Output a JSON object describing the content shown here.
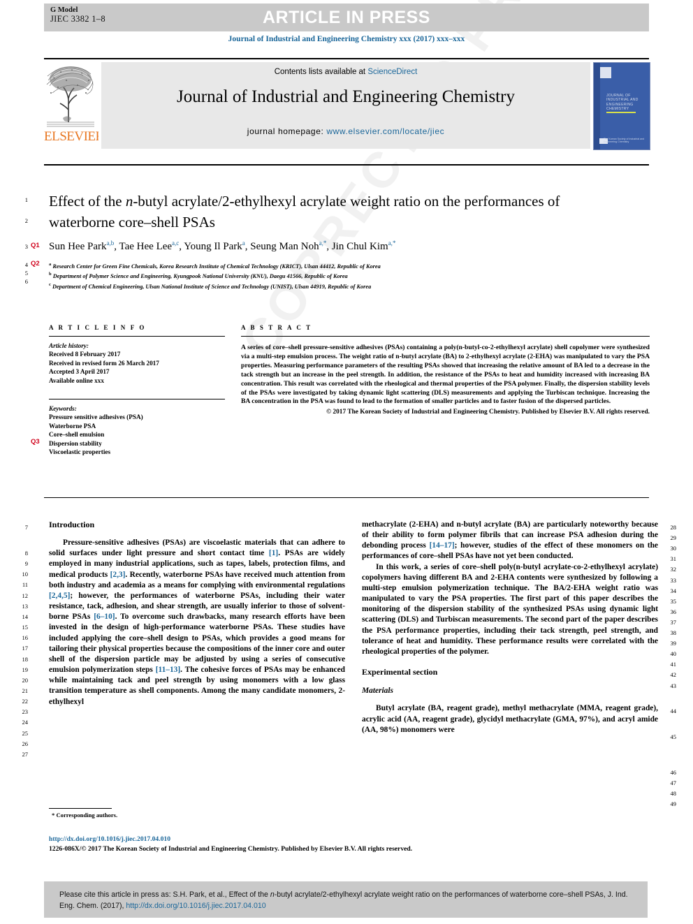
{
  "header": {
    "g_model": "G Model",
    "article_id": "JIEC 3382 1–8",
    "status_banner": "ARTICLE IN PRESS",
    "journal_citation": "Journal of Industrial and Engineering Chemistry xxx (2017) xxx–xxx"
  },
  "masthead": {
    "contents_prefix": "Contents lists available at ",
    "contents_link": "ScienceDirect",
    "journal_title": "Journal of Industrial and Engineering Chemistry",
    "homepage_label": "journal homepage:",
    "homepage_url": "www.elsevier.com/locate/jiec",
    "publisher_logo": "ELSEVIER",
    "cover": {
      "title_lines": "Journal of Industrial and Engineering Chemistry",
      "footer": "The Korean Society of Industrial and Engineering Chemistry"
    }
  },
  "article": {
    "title_part1": "Effect of the ",
    "title_italic": "n",
    "title_part2": "-butyl acrylate/2-ethylhexyl acrylate weight ratio on the performances of waterborne core–shell PSAs",
    "authors_html": "Sun Hee Park, Tae Hee Lee, Young Il Park, Seung Man Noh, Jin Chul Kim",
    "affiliations": [
      "Research Center for Green Fine Chemicals, Korea Research Institute of Chemical Technology (KRICT), Ulsan 44412, Republic of Korea",
      "Department of Polymer Science and Engineering, Kyungpook National University (KNU), Daegu 41566, Republic of Korea",
      "Department of Chemical Engineering, Ulsan National Institute of Science and Technology (UNIST), Ulsan 44919, Republic of Korea"
    ]
  },
  "article_info": {
    "heading": "A R T I C L E   I N F O",
    "history_label": "Article history:",
    "history": [
      "Received 8 February 2017",
      "Received in revised form 26 March 2017",
      "Accepted 3 April 2017",
      "Available online xxx"
    ],
    "keywords_label": "Keywords:",
    "keywords": [
      "Pressure sensitive adhesives (PSA)",
      "Waterborne PSA",
      "Core–shell emulsion",
      "Dispersion stability",
      "Viscoelastic properties"
    ]
  },
  "abstract": {
    "heading": "A B S T R A C T",
    "body": "A series of core–shell pressure-sensitive adhesives (PSAs) containing a poly(n-butyl-co-2-ethylhexyl acrylate) shell copolymer were synthesized via a multi-step emulsion process. The weight ratio of n-butyl acrylate (BA) to 2-ethylhexyl acrylate (2-EHA) was manipulated to vary the PSA properties. Measuring performance parameters of the resulting PSAs showed that increasing the relative amount of BA led to a decrease in the tack strength but an increase in the peel strength. In addition, the resistance of the PSAs to heat and humidity increased with increasing BA concentration. This result was correlated with the rheological and thermal properties of the PSA polymer. Finally, the dispersion stability levels of the PSAs were investigated by taking dynamic light scattering (DLS) measurements and applying the Turbiscan technique. Increasing the BA concentration in the PSA was found to lead to the formation of smaller particles and to faster fusion of the dispersed particles.",
    "copyright": "© 2017 The Korean Society of Industrial and Engineering Chemistry. Published by Elsevier B.V. All rights reserved."
  },
  "body": {
    "introduction_heading": "Introduction",
    "intro_p1": "Pressure-sensitive adhesives (PSAs) are viscoelastic materials that can adhere to solid surfaces under light pressure and short contact time [1]. PSAs are widely employed in many industrial applications, such as tapes, labels, protection films, and medical products [2,3]. Recently, waterborne PSAs have received much attention from both industry and academia as a means for complying with environmental regulations [2,4,5]; however, the performances of waterborne PSAs, including their water resistance, tack, adhesion, and shear strength, are usually inferior to those of solvent-borne PSAs [6–10]. To overcome such drawbacks, many research efforts have been invested in the design of high-performance waterborne PSAs. These studies have included applying the core–shell design to PSAs, which provides a good means for tailoring their physical properties because the compositions of the inner core and outer shell of the dispersion particle may be adjusted by using a series of consecutive emulsion polymerization steps [11–13]. The cohesive forces of PSAs may be enhanced while maintaining tack and peel strength by using monomers with a low glass transition temperature as shell components. Among the many candidate monomers, 2-ethylhexyl methacrylate (2-EHA) and n-butyl acrylate (BA) are particularly noteworthy because of their ability to form polymer fibrils that can increase PSA adhesion during the debonding process [14–17]; however, studies of the effect of these monomers on the performances of core–shell PSAs have not yet been conducted.",
    "intro_p2": "In this work, a series of core–shell poly(n-butyl acrylate-co-2-ethylhexyl acrylate) copolymers having different BA and 2-EHA contents were synthesized by following a multi-step emulsion polymerization technique. The BA/2-EHA weight ratio was manipulated to vary the PSA properties. The first part of this paper describes the monitoring of the dispersion stability of the synthesized PSAs using dynamic light scattering (DLS) and Turbiscan measurements. The second part of the paper describes the PSA performance properties, including their tack strength, peel strength, and tolerance of heat and humidity. These performance results were correlated with the rheological properties of the polymer.",
    "experimental_heading": "Experimental section",
    "materials_heading": "Materials",
    "materials_p1": "Butyl acrylate (BA, reagent grade), methyl methacrylate (MMA, reagent grade), acrylic acid (AA, reagent grade), glycidyl methacrylate (GMA, 97%), and acryl amide (AA, 98%) monomers were"
  },
  "footnote": {
    "marker": "*",
    "text": "Corresponding authors."
  },
  "bottom_meta": {
    "doi": "http://dx.doi.org/10.1016/j.jiec.2017.04.010",
    "issn_copyright": "1226-086X/© 2017 The Korean Society of Industrial and Engineering Chemistry. Published by Elsevier B.V. All rights reserved."
  },
  "cite_box": {
    "prefix": "Please cite this article in press as: S.H. Park, et al., Effect of the ",
    "italic": "n",
    "middle": "-butyl acrylate/2-ethylhexyl acrylate weight ratio on the performances of waterborne core–shell PSAs, J. Ind. Eng. Chem. (2017), ",
    "url": "http://dx.doi.org/10.1016/j.jiec.2017.04.010"
  },
  "line_numbers": {
    "left": [
      "1",
      "2",
      "3",
      "4",
      "5",
      "6",
      "7",
      "8",
      "9",
      "10",
      "11",
      "12",
      "13",
      "14",
      "15",
      "16",
      "17",
      "18",
      "19",
      "20",
      "21",
      "22",
      "23",
      "24",
      "25",
      "26",
      "27"
    ],
    "right": [
      "28",
      "29",
      "30",
      "31",
      "32",
      "33",
      "34",
      "35",
      "36",
      "37",
      "38",
      "39",
      "40",
      "41",
      "42",
      "43",
      "44",
      "45",
      "46",
      "47",
      "48",
      "49"
    ]
  },
  "query_markers": [
    {
      "id": "Q1"
    },
    {
      "id": "Q2"
    },
    {
      "id": "Q3"
    }
  ],
  "watermark": "CORRECTED PROOF",
  "colors": {
    "link": "#1a6699",
    "banner_bg": "#c9c9c9",
    "query_red": "#d0021b",
    "elsevier_orange": "#E87722"
  }
}
